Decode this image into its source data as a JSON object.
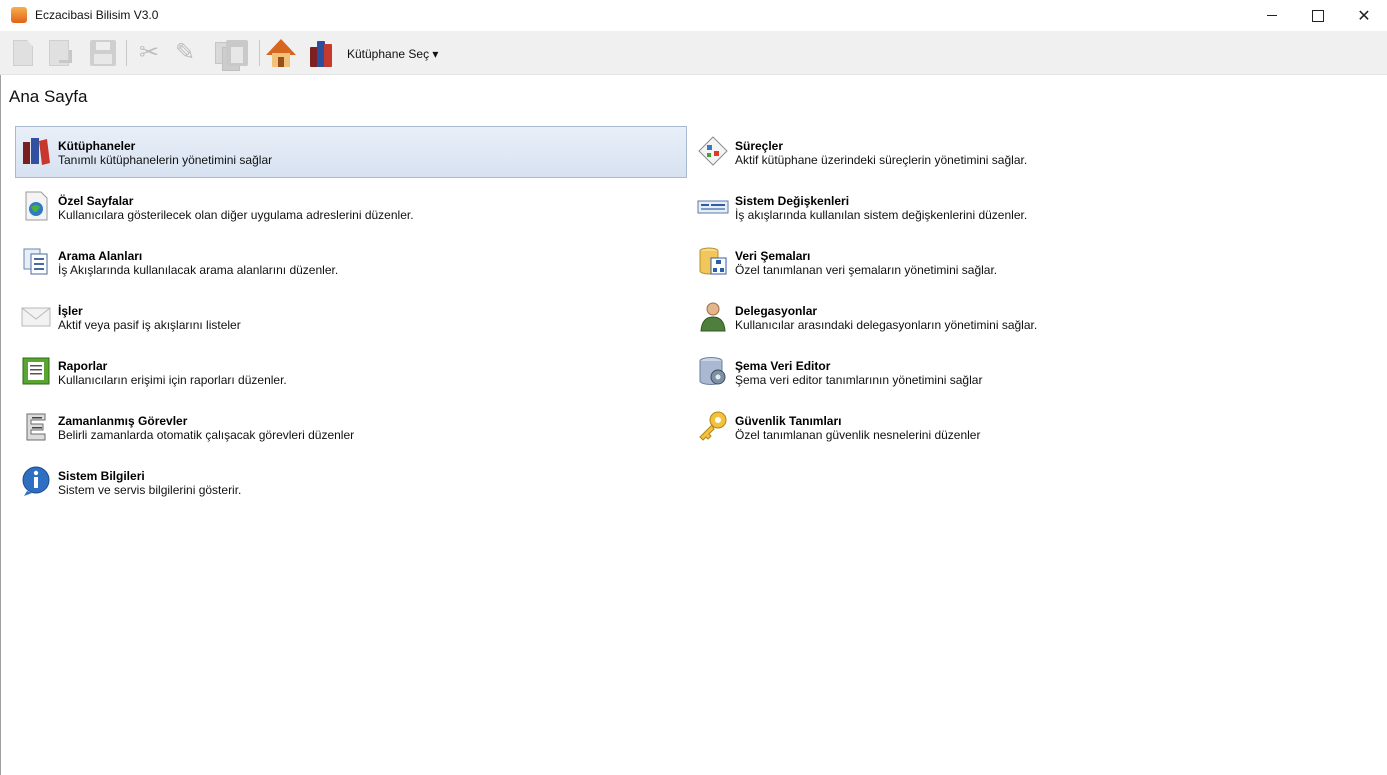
{
  "window": {
    "title": "Eczacibasi Bilisim V3.0",
    "min": "",
    "max": "",
    "close": "✕"
  },
  "toolbar": {
    "library_select": "Kütüphane Seç ▾"
  },
  "page": {
    "title": "Ana Sayfa"
  },
  "items": [
    {
      "name": "Kütüphaneler",
      "desc": "Tanımlı kütüphanelerin yönetimini sağlar",
      "icon": "library-icon"
    },
    {
      "name": "Süreçler",
      "desc": "Aktif kütüphane üzerindeki süreçlerin yönetimini sağlar.",
      "icon": "process-icon"
    },
    {
      "name": "Özel Sayfalar",
      "desc": "Kullanıcılara gösterilecek olan diğer uygulama adreslerini düzenler.",
      "icon": "globe-page-icon"
    },
    {
      "name": "Sistem Değişkenleri",
      "desc": "İş akışlarında kullanılan sistem değişkenlerini düzenler.",
      "icon": "variables-icon"
    },
    {
      "name": "Arama Alanları",
      "desc": "İş Akışlarında kullanılacak arama alanlarını düzenler.",
      "icon": "search-fields-icon"
    },
    {
      "name": "Veri Şemaları",
      "desc": "Özel tanımlanan veri şemaların yönetimini sağlar.",
      "icon": "database-schema-icon"
    },
    {
      "name": "İşler",
      "desc": "Aktif veya pasif iş akışlarını listeler",
      "icon": "envelope-icon"
    },
    {
      "name": "Delegasyonlar",
      "desc": "Kullanıcılar arasındaki delegasyonların yönetimini sağlar.",
      "icon": "user-icon"
    },
    {
      "name": "Raporlar",
      "desc": "Kullanıcıların erişimi için raporları düzenler.",
      "icon": "report-icon"
    },
    {
      "name": "Şema Veri Editor",
      "desc": "Şema veri editor tanımlarının yönetimini sağlar",
      "icon": "schema-editor-icon"
    },
    {
      "name": "Zamanlanmış Görevler",
      "desc": "Belirli zamanlarda otomatik çalışacak görevleri düzenler",
      "icon": "scheduled-tasks-icon"
    },
    {
      "name": "Güvenlik Tanımları",
      "desc": "Özel tanımlanan güvenlik nesnelerini düzenler",
      "icon": "key-icon"
    },
    {
      "name": "Sistem Bilgileri",
      "desc": "Sistem ve servis bilgilerini gösterir.",
      "icon": "info-icon"
    }
  ]
}
